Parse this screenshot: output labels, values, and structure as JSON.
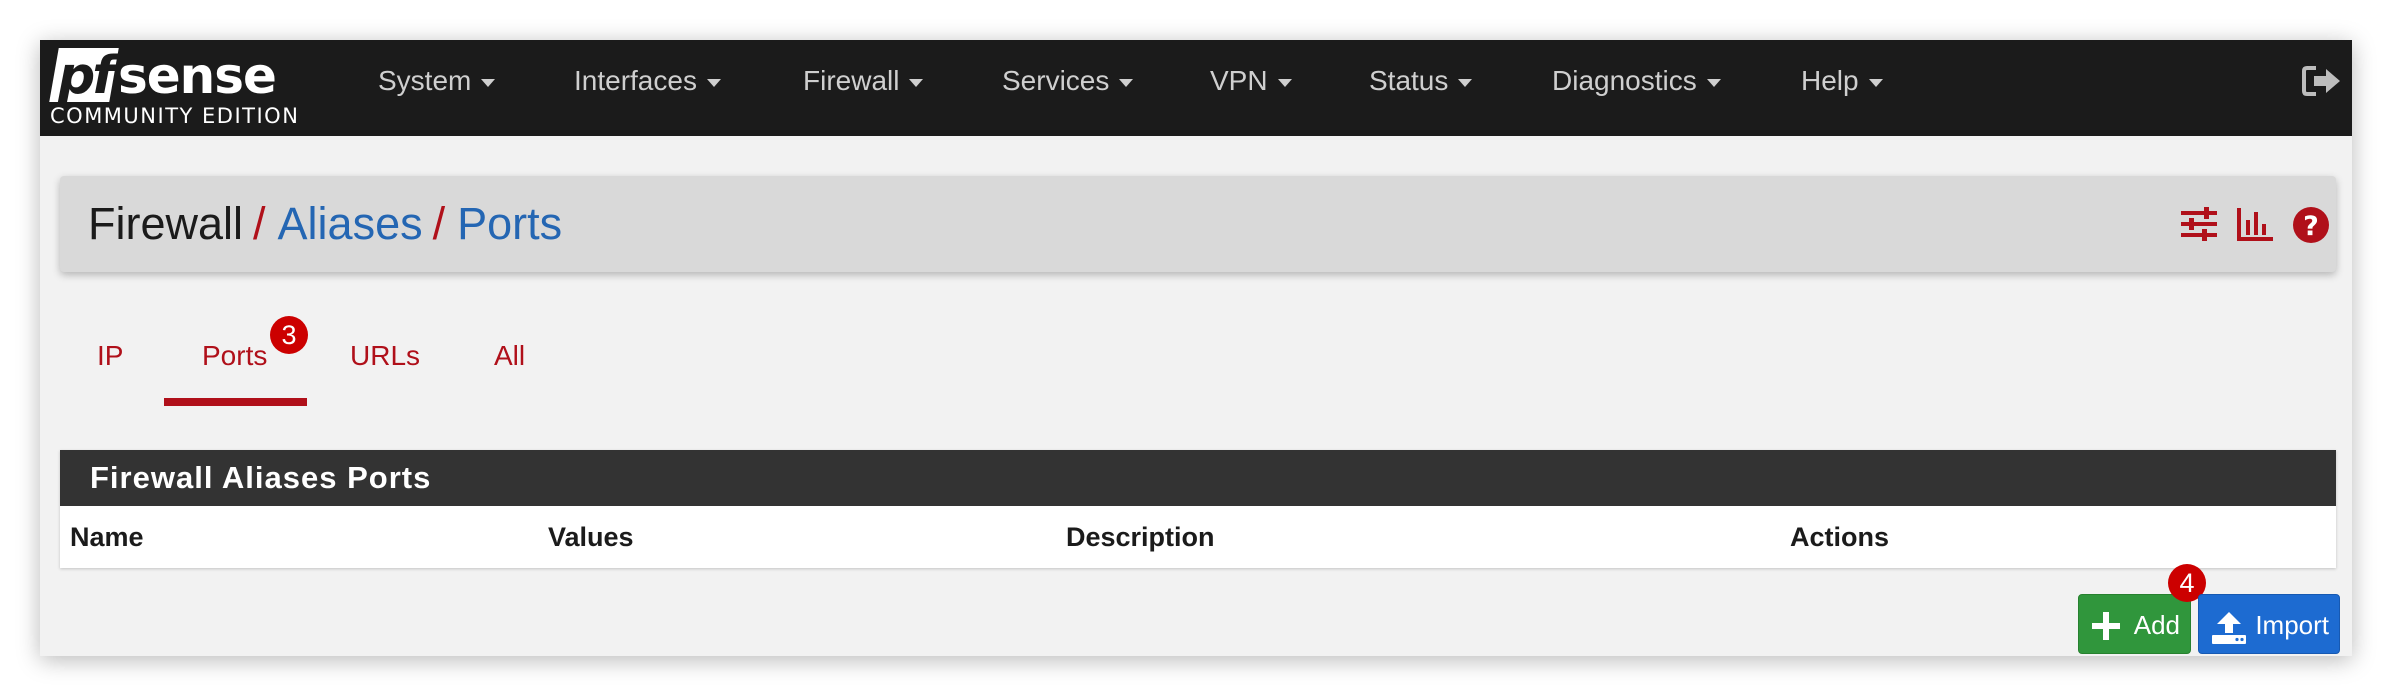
{
  "brand": {
    "logo_text_pf": "pf",
    "logo_text_sense": "sense",
    "edition": "COMMUNITY EDITION"
  },
  "nav": {
    "items": [
      {
        "label": "System"
      },
      {
        "label": "Interfaces"
      },
      {
        "label": "Firewall"
      },
      {
        "label": "Services"
      },
      {
        "label": "VPN"
      },
      {
        "label": "Status"
      },
      {
        "label": "Diagnostics"
      },
      {
        "label": "Help"
      }
    ],
    "logout_icon": "sign-out-icon"
  },
  "breadcrumb": {
    "root": "Firewall",
    "sep": "/",
    "level2": "Aliases",
    "level3": "Ports"
  },
  "header_icons": [
    "sliders-icon",
    "chart-bar-icon",
    "question-circle-icon"
  ],
  "tabs": {
    "items": [
      {
        "label": "IP"
      },
      {
        "label": "Ports"
      },
      {
        "label": "URLs"
      },
      {
        "label": "All"
      }
    ],
    "active": "Ports",
    "active_badge": "3"
  },
  "table": {
    "title": "Firewall Aliases Ports",
    "columns": [
      "Name",
      "Values",
      "Description",
      "Actions"
    ],
    "rows": []
  },
  "buttons": {
    "add_label": "Add",
    "add_badge": "4",
    "import_label": "Import"
  },
  "colors": {
    "accent": "#b0101a",
    "link": "#2466b3",
    "add": "#30963c",
    "import": "#1d6bd1",
    "navbar": "#1b1b1b"
  }
}
